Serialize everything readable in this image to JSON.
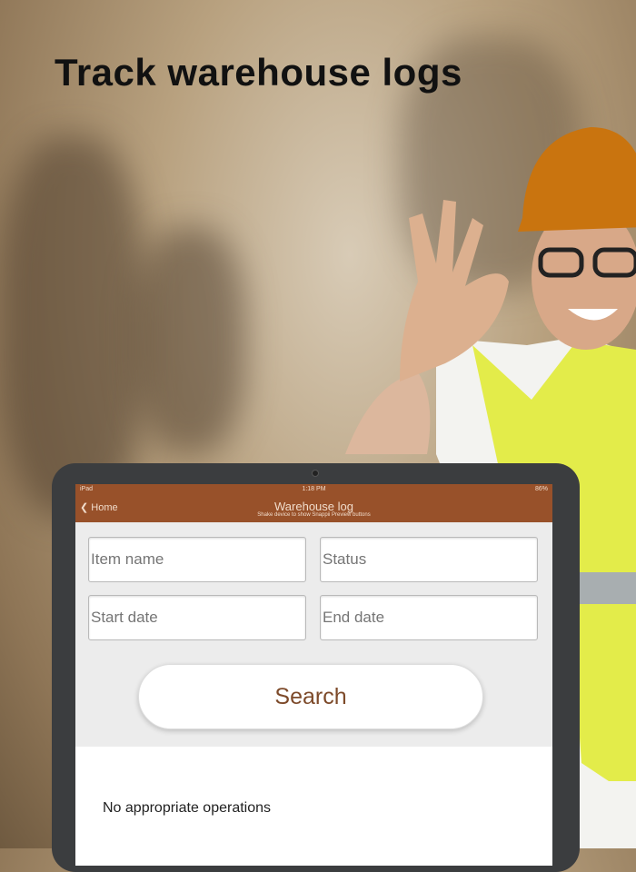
{
  "headline": "Track warehouse logs",
  "status_bar": {
    "device": "iPad",
    "time": "1:18 PM",
    "battery": "86%"
  },
  "nav": {
    "back_label": "Home",
    "title": "Warehouse log",
    "subtitle": "Shake device to show Snappii Preview buttons"
  },
  "form": {
    "item_name_placeholder": "Item name",
    "status_placeholder": "Status",
    "start_date_placeholder": "Start date",
    "end_date_placeholder": "End date",
    "search_label": "Search"
  },
  "results": {
    "empty_text": "No appropriate operations"
  },
  "colors": {
    "nav": "#98512a",
    "accent": "#7d4a2a"
  }
}
